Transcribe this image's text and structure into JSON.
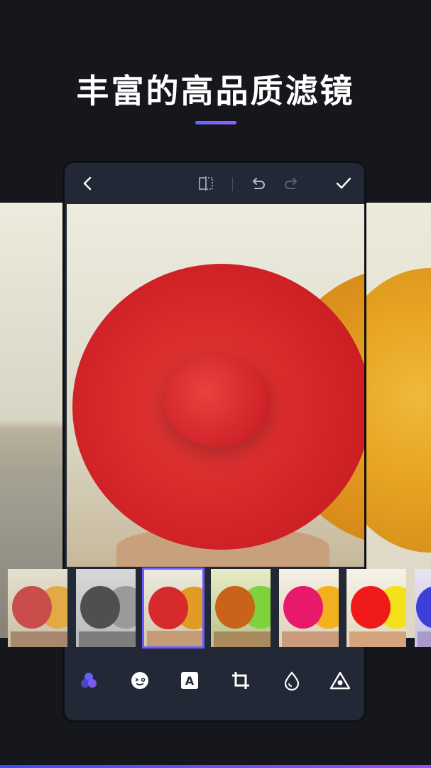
{
  "headline": "丰富的高品质滤镜",
  "colors": {
    "accent_start": "#5b6dff",
    "accent_end": "#9b5bff",
    "background": "#16161d",
    "panel": "#222835",
    "selected_border": "#6a5cff"
  },
  "editor_topbar": {
    "icons": [
      "back-icon",
      "compare-icon",
      "undo-icon",
      "redo-icon",
      "check-icon"
    ]
  },
  "filters": {
    "selected_index": 2,
    "items": [
      {
        "icon": "filter-vintage"
      },
      {
        "icon": "filter-mono"
      },
      {
        "icon": "filter-original"
      },
      {
        "icon": "filter-warm"
      },
      {
        "icon": "filter-vivid"
      },
      {
        "icon": "filter-pop"
      },
      {
        "icon": "filter-cool"
      }
    ]
  },
  "toolbar": {
    "tools": [
      "filter-icon",
      "sticker-icon",
      "text-icon",
      "crop-icon",
      "adjust-icon",
      "effect-icon"
    ],
    "text_tool_glyph": "A"
  }
}
